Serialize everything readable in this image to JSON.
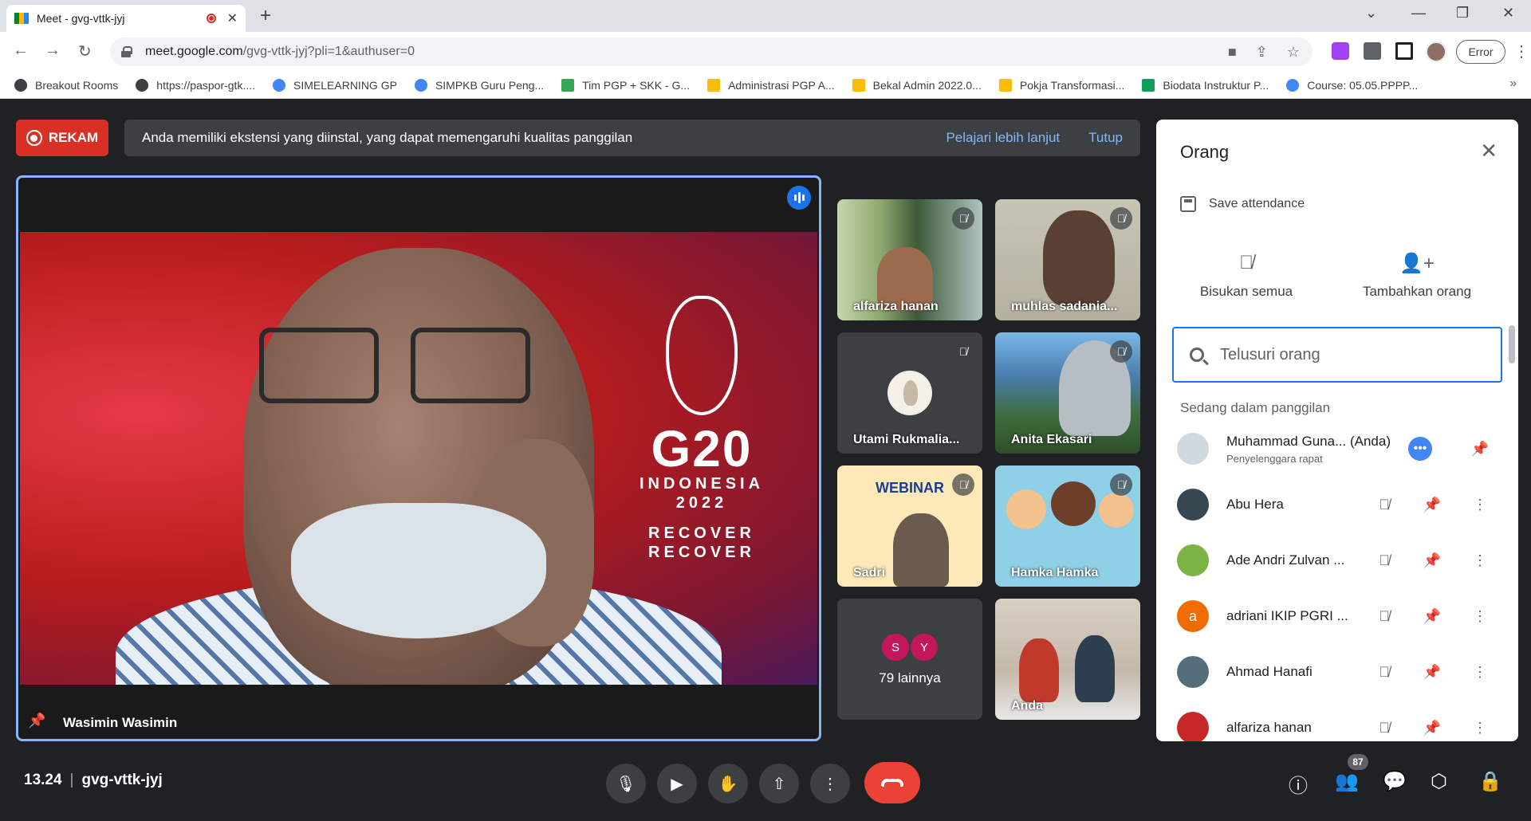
{
  "browser": {
    "tab_title": "Meet - gvg-vttk-jyj",
    "tab_close": "✕",
    "new_tab": "+",
    "url_host": "meet.google.com",
    "url_path": "/gvg-vttk-jyj?pli=1&authuser=0",
    "error_button": "Error",
    "bookmarks": [
      {
        "label": "Breakout Rooms",
        "color": "#3c4043"
      },
      {
        "label": "https://paspor-gtk....",
        "color": "#3c4043"
      },
      {
        "label": "SIMELEARNING GP",
        "color": "#4285f4"
      },
      {
        "label": "SIMPKB Guru Peng...",
        "color": "#4285f4"
      },
      {
        "label": "Tim PGP + SKK - G...",
        "color": "#34a853"
      },
      {
        "label": "Administrasi PGP A...",
        "color": "#fbbc04"
      },
      {
        "label": "Bekal Admin 2022.0...",
        "color": "#fbbc04"
      },
      {
        "label": "Pokja Transformasi...",
        "color": "#fbbc04"
      },
      {
        "label": "Biodata Instruktur P...",
        "color": "#0f9d58"
      },
      {
        "label": "Course: 05.05.PPPP...",
        "color": "#4285f4"
      }
    ]
  },
  "meet": {
    "record_label": "REKAM",
    "notice": {
      "message": "Anda memiliki ekstensi yang diinstal, yang dapat memengaruhi kualitas panggilan",
      "learn_more": "Pelajari lebih lanjut",
      "close": "Tutup"
    },
    "main_speaker": "Wasimin Wasimin",
    "g20": {
      "title": "G20",
      "line1": "INDONESIA",
      "line2": "2022",
      "line3": "RECOVER",
      "line4": "RECOVER"
    },
    "tiles": [
      {
        "name": "alfariza hanan"
      },
      {
        "name": "muhlas sadania..."
      },
      {
        "name": "Utami Rukmalia..."
      },
      {
        "name": "Anita Ekasari"
      },
      {
        "name": "Sadri",
        "webinar_label": "WEBINAR"
      },
      {
        "name": "Hamka Hamka"
      },
      {
        "name": "79 lainnya",
        "initials": [
          "S",
          "Y"
        ]
      },
      {
        "name": "Anda"
      }
    ],
    "meeting_time": "13.24",
    "meeting_code": "gvg-vttk-jyj",
    "participant_count": "87"
  },
  "people_panel": {
    "title": "Orang",
    "save_attendance": "Save attendance",
    "mute_all": "Bisukan semua",
    "add_people": "Tambahkan orang",
    "search_placeholder": "Telusuri orang",
    "section_label": "Sedang dalam panggilan",
    "participants": [
      {
        "name": "Muhammad Guna... (Anda)",
        "role": "Penyelenggara rapat",
        "avatar_color": "#cfd8dc"
      },
      {
        "name": "Abu Hera",
        "avatar_color": "#37474f"
      },
      {
        "name": "Ade Andri Zulvan ...",
        "avatar_color": "#7cb342"
      },
      {
        "name": "adriani IKIP PGRI ...",
        "avatar_color": "#ef6c00",
        "initial": "a"
      },
      {
        "name": "Ahmad Hanafi",
        "avatar_color": "#546e7a"
      },
      {
        "name": "alfariza hanan",
        "avatar_color": "#c62828"
      }
    ]
  }
}
